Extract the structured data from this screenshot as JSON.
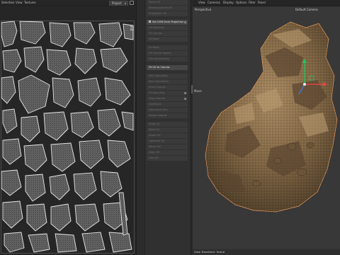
{
  "uv_editor": {
    "menu": [
      "Selection",
      "View",
      "Textures"
    ],
    "mode_select": "Project"
  },
  "tools": {
    "rows": [
      {
        "label": "Relax UV",
        "active": false,
        "info": false,
        "check": false
      },
      {
        "label": "Rectangularize UV",
        "active": false,
        "info": false,
        "check": false
      },
      {
        "label": "Straighten UV",
        "active": false,
        "info": false,
        "check": false
      },
      {
        "label": "",
        "gap": true
      },
      {
        "label": "Set UVW from Projection",
        "active": true,
        "info": true,
        "check": true
      },
      {
        "label": "Fit Selection",
        "active": false,
        "info": false,
        "check": false
      },
      {
        "label": "Fit Canvas",
        "active": false,
        "info": false,
        "check": false
      },
      {
        "label": "Fit Mesh",
        "active": false,
        "info": false,
        "check": false
      },
      {
        "label": "",
        "gap": true
      },
      {
        "label": "Fit Mesh",
        "active": false,
        "info": false,
        "check": false
      },
      {
        "label": "Fit Canvas Aspect",
        "active": false,
        "info": false,
        "check": false
      },
      {
        "label": "Flip Horizontally",
        "active": false,
        "info": false,
        "check": false
      },
      {
        "label": "",
        "gap": true
      },
      {
        "label": "Fit UV to Canvas",
        "active": true,
        "info": false,
        "check": false
      },
      {
        "label": "",
        "gap": true
      },
      {
        "label": "Pack Bounding",
        "active": false,
        "info": false,
        "check": false
      },
      {
        "label": "Pack Geometric",
        "active": false,
        "info": false,
        "check": false
      },
      {
        "label": "Stack Islands",
        "active": false,
        "info": false,
        "check": false
      },
      {
        "label": "Fit Bounding",
        "active": false,
        "info": true,
        "check": false
      },
      {
        "label": "Align Islands",
        "active": false,
        "info": true,
        "check": false
      },
      {
        "label": "Distribute",
        "active": false,
        "info": false,
        "check": false
      },
      {
        "label": "Normalize Size",
        "active": false,
        "info": false,
        "check": false
      },
      {
        "label": "Rotate Islands",
        "active": false,
        "info": false,
        "check": false
      },
      {
        "label": "",
        "gap": true
      },
      {
        "label": "Snap UV",
        "active": false,
        "info": false,
        "check": false
      },
      {
        "label": "Weld UV",
        "active": false,
        "info": false,
        "check": false
      },
      {
        "label": "Break UV",
        "active": false,
        "info": false,
        "check": false
      },
      {
        "label": "Optimize UV",
        "active": false,
        "info": false,
        "check": false
      },
      {
        "label": "Mirror UV",
        "active": false,
        "info": false,
        "check": false
      },
      {
        "label": "Align UV",
        "active": false,
        "info": false,
        "check": false
      },
      {
        "label": "Grid UV",
        "active": false,
        "info": false,
        "check": false
      }
    ]
  },
  "viewport": {
    "menu": [
      "View",
      "Cameras",
      "Display",
      "Options",
      "Filter",
      "Panel"
    ],
    "view_name": "Perspective",
    "camera_name": "Default Camera",
    "axis_label": "Move",
    "footer_label": "View Transform: Scene"
  },
  "colors": {
    "axis_y": "#22c55e",
    "axis_x": "#ef4444",
    "axis_z": "#3b82f6"
  }
}
